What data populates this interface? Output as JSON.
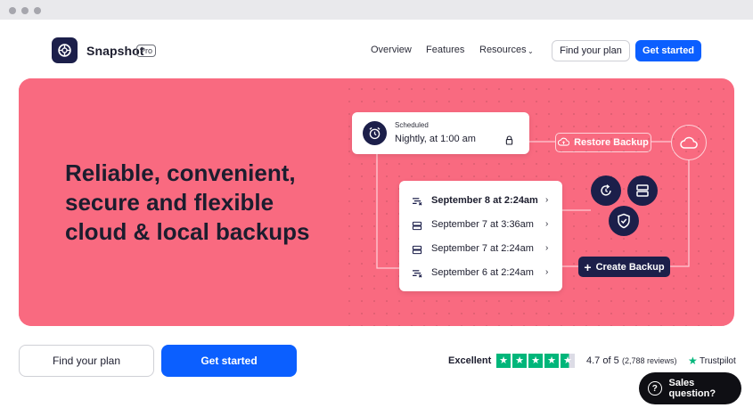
{
  "header": {
    "brand": "Snapshot",
    "badge": "Pro",
    "nav": {
      "overview": "Overview",
      "features": "Features",
      "resources": "Resources"
    },
    "find_plan": "Find your plan",
    "get_started": "Get started"
  },
  "hero": {
    "headline": "Reliable, convenient, secure and flexible cloud & local backups",
    "scheduled": {
      "title": "Scheduled",
      "time": "Nightly, at 1:00 am"
    },
    "restore_label": "Restore Backup",
    "backups": [
      {
        "label": "September 8 at 2:24am",
        "icon": "cloud-backup-icon"
      },
      {
        "label": "September 7 at 3:36am",
        "icon": "server-icon"
      },
      {
        "label": "September 7 at 2:24am",
        "icon": "server-icon"
      },
      {
        "label": "September 6 at 2:24am",
        "icon": "cloud-backup-icon"
      }
    ],
    "create_label": "Create Backup"
  },
  "cta": {
    "find_plan": "Find your plan",
    "get_started": "Get started"
  },
  "trustpilot": {
    "excellent": "Excellent",
    "rating": 4.7,
    "score": "4.7 of 5",
    "reviews": "(2,788 reviews)",
    "brand": "Trustpilot"
  },
  "sales": {
    "label": "Sales question?"
  },
  "colors": {
    "hero": "#f96a80",
    "navy": "#1c1f4a",
    "primary": "#0b5fff",
    "trustpilot": "#00b67a"
  }
}
